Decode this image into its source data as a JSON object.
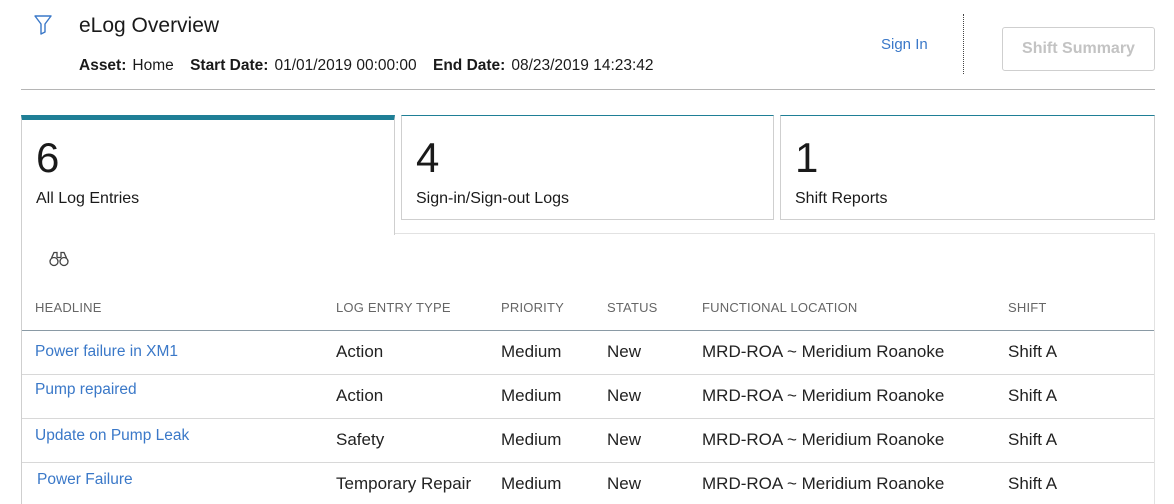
{
  "header": {
    "filter_icon": "filter-icon",
    "title": "eLog Overview",
    "meta": {
      "asset_label": "Asset:",
      "asset_value": "Home",
      "start_label": "Start Date:",
      "start_value": "01/01/2019 00:00:00",
      "end_label": "End Date:",
      "end_value": "08/23/2019 14:23:42"
    },
    "sign_in": "Sign In",
    "shift_summary": "Shift Summary"
  },
  "tiles": [
    {
      "count": "6",
      "label": "All Log Entries",
      "active": true
    },
    {
      "count": "4",
      "label": "Sign-in/Sign-out Logs",
      "active": false
    },
    {
      "count": "1",
      "label": "Shift Reports",
      "active": false
    }
  ],
  "toolbar": {
    "search_icon": "binoculars-icon"
  },
  "table": {
    "columns": [
      "HEADLINE",
      "LOG ENTRY TYPE",
      "PRIORITY",
      "STATUS",
      "FUNCTIONAL LOCATION",
      "SHIFT"
    ],
    "rows": [
      [
        "Power failure in XM1",
        "Action",
        "Medium",
        "New",
        "MRD-ROA ~ Meridium Roanoke",
        "Shift A"
      ],
      [
        "Pump repaired",
        "Action",
        "Medium",
        "New",
        "MRD-ROA ~ Meridium Roanoke",
        "Shift A"
      ],
      [
        "Update on Pump Leak",
        "Safety",
        "Medium",
        "New",
        "MRD-ROA ~ Meridium Roanoke",
        "Shift A"
      ],
      [
        "Power Failure",
        "Temporary Repair",
        "Medium",
        "New",
        "MRD-ROA ~ Meridium Roanoke",
        "Shift A"
      ]
    ]
  },
  "colors": {
    "accent": "#1f7f96",
    "link": "#3a78c8"
  }
}
